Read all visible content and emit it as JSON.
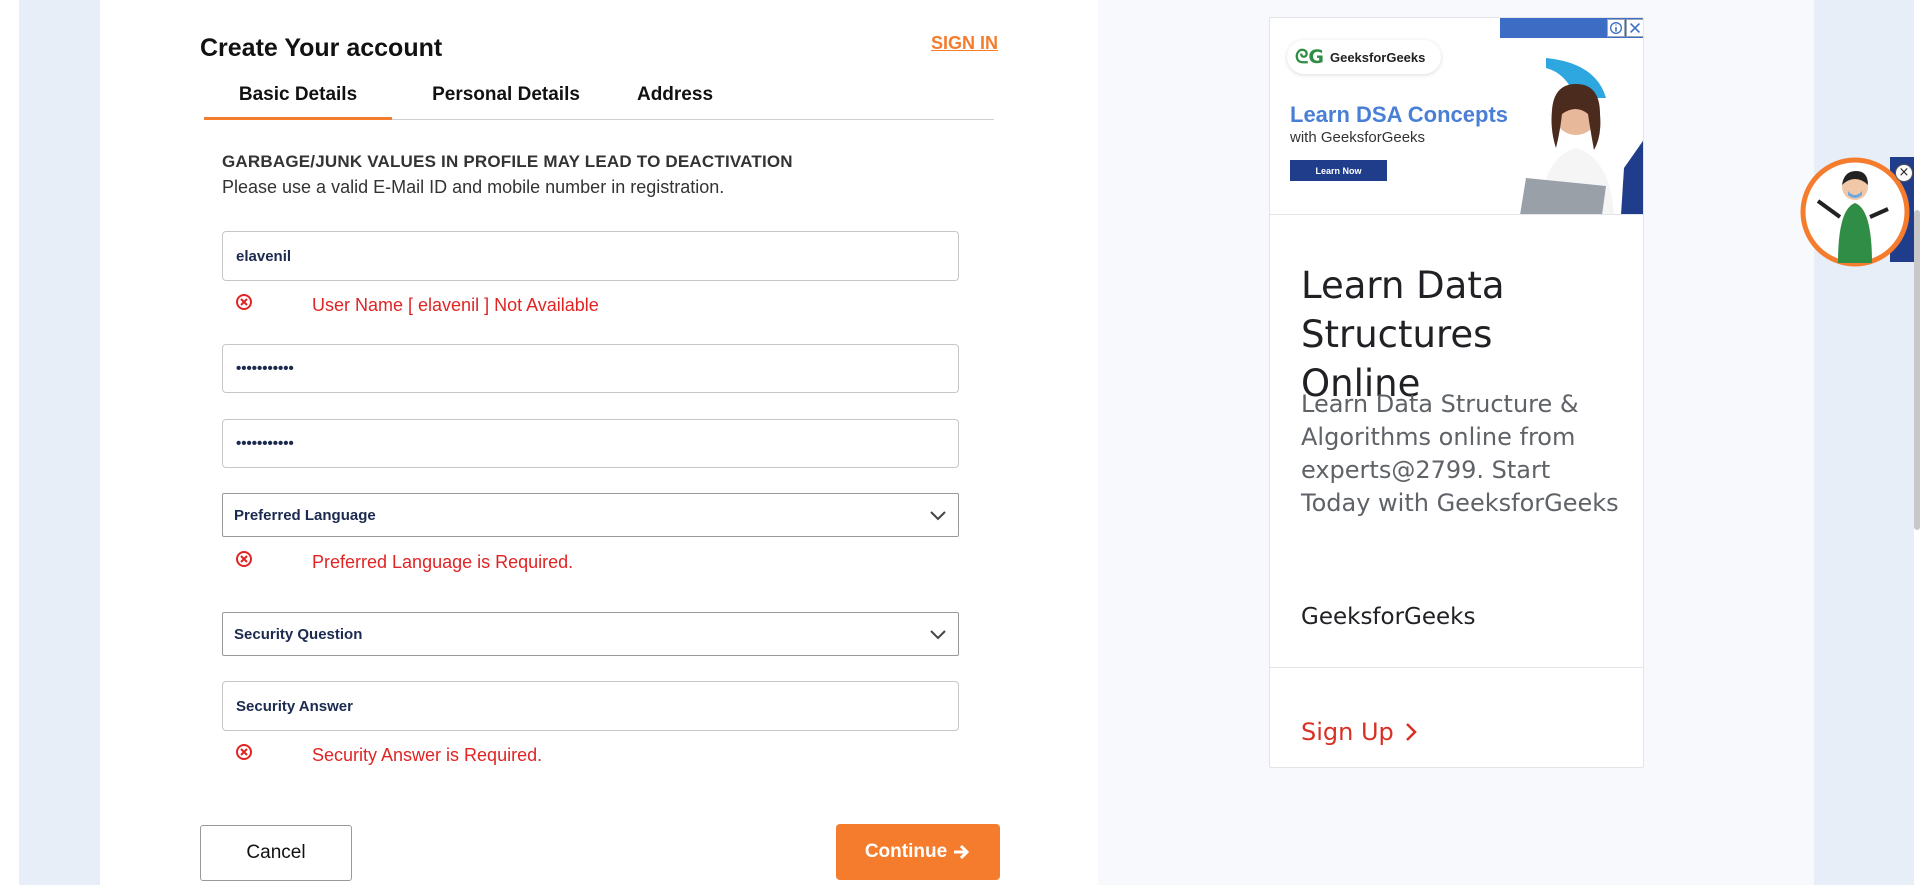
{
  "form": {
    "title": "Create Your account",
    "signin_label": "SIGN IN",
    "tabs": [
      {
        "label": "Basic Details",
        "active": true
      },
      {
        "label": "Personal Details",
        "active": false
      },
      {
        "label": "Address",
        "active": false
      }
    ],
    "warning_title": "GARBAGE/JUNK VALUES IN PROFILE MAY LEAD TO DEACTIVATION",
    "warning_sub": "Please use a valid E-Mail ID and mobile number in registration.",
    "username_value": "elavenil",
    "username_error": "User Name [ elavenil ] Not Available",
    "password_mask": "•••••••••••",
    "confirm_mask": "•••••••••••",
    "language_select": "Preferred Language",
    "language_error": "Preferred Language is Required.",
    "question_select": "Security Question",
    "answer_placeholder": "Security Answer",
    "answer_error": "Security Answer is Required.",
    "cancel_label": "Cancel",
    "continue_label": "Continue",
    "accent_color": "#f47c2c",
    "error_color": "#e02424"
  },
  "ad": {
    "logo_mark": "ᘓG",
    "logo_text": "GeeksforGeeks",
    "banner_headline": "Learn DSA Concepts",
    "banner_sub": "with GeeksforGeeks",
    "banner_button": "Learn Now",
    "title": "Learn Data Structures Online",
    "description": "Learn Data Structure & Algorithms online from experts@2799. Start Today with GeeksforGeeks",
    "brand": "GeeksforGeeks",
    "signup_label": "Sign Up",
    "signup_color": "#d93025",
    "info_icon": "info-icon",
    "close_icon": "close-icon"
  },
  "mascot": {
    "close_glyph": "×"
  }
}
